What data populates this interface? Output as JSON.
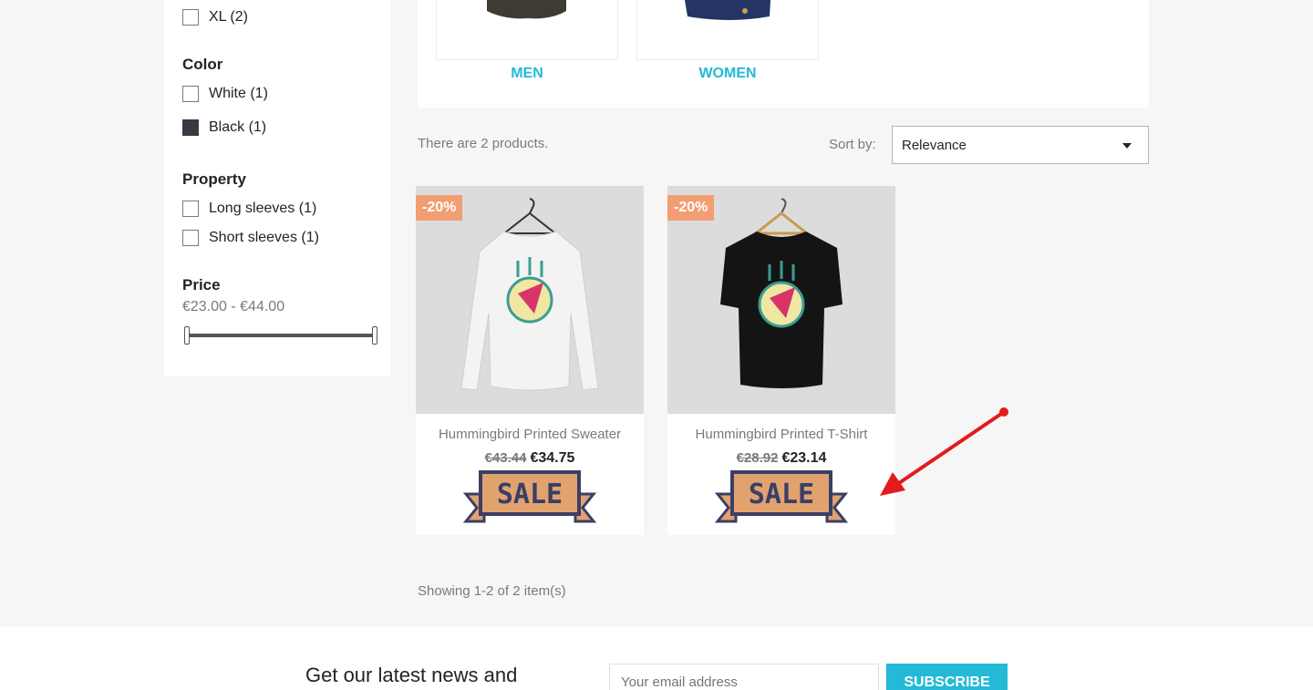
{
  "sidebar": {
    "size_items": [
      {
        "label": "XL (2)"
      }
    ],
    "color_title": "Color",
    "color_items": [
      {
        "label": "White (1)"
      },
      {
        "label": "Black (1)"
      }
    ],
    "property_title": "Property",
    "property_items": [
      {
        "label": "Long sleeves (1)"
      },
      {
        "label": "Short sleeves (1)"
      }
    ],
    "price_title": "Price",
    "price_range": "€23.00 - €44.00"
  },
  "categories": [
    {
      "label": "MEN"
    },
    {
      "label": "WOMEN"
    }
  ],
  "listing": {
    "product_count": "There are 2 products.",
    "sort_label": "Sort by:",
    "sort_value": "Relevance",
    "showing": "Showing 1-2 of 2 item(s)"
  },
  "products": [
    {
      "name": "Hummingbird Printed Sweater",
      "discount": "-20%",
      "old_price": "€43.44",
      "price": "€34.75",
      "sale_text": "SALE"
    },
    {
      "name": "Hummingbird Printed T-Shirt",
      "discount": "-20%",
      "old_price": "€28.92",
      "price": "€23.14",
      "sale_text": "SALE"
    }
  ],
  "footer": {
    "newsletter_title": "Get our latest news and",
    "email_placeholder": "Your email address",
    "subscribe_label": "SUBSCRIBE"
  },
  "colors": {
    "accent": "#24b9d7",
    "discount": "#f39d72",
    "arrow": "#e31b1b"
  }
}
